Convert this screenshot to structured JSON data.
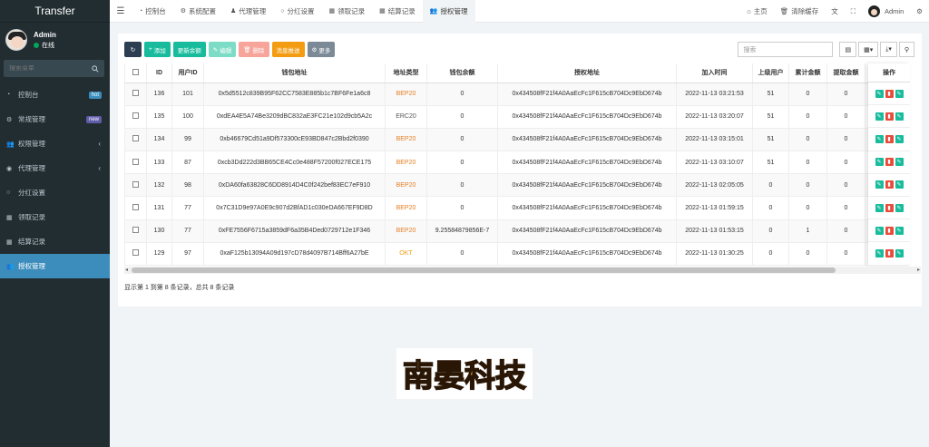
{
  "brand": "Transfer",
  "user": {
    "name": "Admin",
    "status": "在线"
  },
  "sidebar_search": {
    "placeholder": "搜索菜单"
  },
  "sidebar": {
    "items": [
      {
        "label": "控制台",
        "badge": "hot"
      },
      {
        "label": "常规管理",
        "badge": "new"
      },
      {
        "label": "权限管理"
      },
      {
        "label": "代理管理"
      },
      {
        "label": "分红设置"
      },
      {
        "label": "领取记录"
      },
      {
        "label": "结算记录"
      },
      {
        "label": "授权管理"
      }
    ]
  },
  "topbar": {
    "tabs": [
      "控制台",
      "系统配置",
      "代理管理",
      "分红设置",
      "领取记录",
      "结算记录",
      "授权管理"
    ],
    "home": "主页",
    "clear_cache": "清除缓存",
    "admin": "Admin"
  },
  "toolbar": {
    "add": "添加",
    "update_balance": "更新余额",
    "edit": "编辑",
    "delete": "删除",
    "message_push": "消息推送",
    "more": "更多",
    "search_placeholder": "搜索"
  },
  "table": {
    "headers": [
      "ID",
      "用户ID",
      "钱包地址",
      "地址类型",
      "钱包余额",
      "授权地址",
      "加入时间",
      "上级用户",
      "累计金额",
      "提取金额",
      "操作"
    ],
    "rows": [
      {
        "id": "136",
        "uid": "101",
        "wallet": "0x5d5512c839B95F62CC7583E885b1c7BF6Fe1a6c8",
        "type": "BEP20",
        "balance": "0",
        "auth": "0x434508fF21f4A0AaEcFc1F615cB704Dc9EbD674b",
        "time": "2022-11-13 03:21:53",
        "parent": "51",
        "total": "0",
        "withdraw": "0"
      },
      {
        "id": "135",
        "uid": "100",
        "wallet": "0xdEA4E5A74Be3209dBC832aE3FC21e102d9cb5A2c",
        "type": "ERC20",
        "balance": "0",
        "auth": "0x434508fF21f4A0AaEcFc1F615cB704Dc9EbD674b",
        "time": "2022-11-13 03:20:07",
        "parent": "51",
        "total": "0",
        "withdraw": "0"
      },
      {
        "id": "134",
        "uid": "99",
        "wallet": "0xb46679Cd51a9Df573300cE93BD847c2Bbd2f0390",
        "type": "BEP20",
        "balance": "0",
        "auth": "0x434508fF21f4A0AaEcFc1F615cB704Dc9EbD674b",
        "time": "2022-11-13 03:15:01",
        "parent": "51",
        "total": "0",
        "withdraw": "0"
      },
      {
        "id": "133",
        "uid": "87",
        "wallet": "0xcb3Dd222d3BB65CE4Cc0e488F57200f027ECE175",
        "type": "BEP20",
        "balance": "0",
        "auth": "0x434508fF21f4A0AaEcFc1F615cB704Dc9EbD674b",
        "time": "2022-11-13 03:10:07",
        "parent": "51",
        "total": "0",
        "withdraw": "0"
      },
      {
        "id": "132",
        "uid": "98",
        "wallet": "0xDA60fa63828C6DD8914D4C0f242bef83EC7eF910",
        "type": "BEP20",
        "balance": "0",
        "auth": "0x434508fF21f4A0AaEcFc1F615cB704Dc9EbD674b",
        "time": "2022-11-13 02:05:05",
        "parent": "0",
        "total": "0",
        "withdraw": "0"
      },
      {
        "id": "131",
        "uid": "77",
        "wallet": "0x7C31D9e97A0E9c907d2BfAD1c030eDA667EF9D8D",
        "type": "BEP20",
        "balance": "0",
        "auth": "0x434508fF21f4A0AaEcFc1F615cB704Dc9EbD674b",
        "time": "2022-11-13 01:59:15",
        "parent": "0",
        "total": "0",
        "withdraw": "0"
      },
      {
        "id": "130",
        "uid": "77",
        "wallet": "0xFE7556F6715a3859dF6a35B4Ded0729712e1F346",
        "type": "BEP20",
        "balance": "9.25584879856E-7",
        "auth": "0x434508fF21f4A0AaEcFc1F615cB704Dc9EbD674b",
        "time": "2022-11-13 01:53:15",
        "parent": "0",
        "total": "1",
        "withdraw": "0"
      },
      {
        "id": "129",
        "uid": "97",
        "wallet": "0xaF125b13094A09d197cD78d4097B714Bff6A27bE",
        "type": "OKT",
        "balance": "0",
        "auth": "0x434508fF21f4A0AaEcFc1F615cB704Dc9EbD674b",
        "time": "2022-11-13 01:30:25",
        "parent": "0",
        "total": "0",
        "withdraw": "0"
      }
    ]
  },
  "summary": "显示第 1 到第 8 条记录，总共 8 条记录",
  "logo_text": "南晏科技",
  "colors": {
    "sidebar_bg": "#222d32",
    "active": "#3c8dbc",
    "success": "#18bc9c",
    "danger": "#e74c3c",
    "warning": "#f39c12"
  }
}
